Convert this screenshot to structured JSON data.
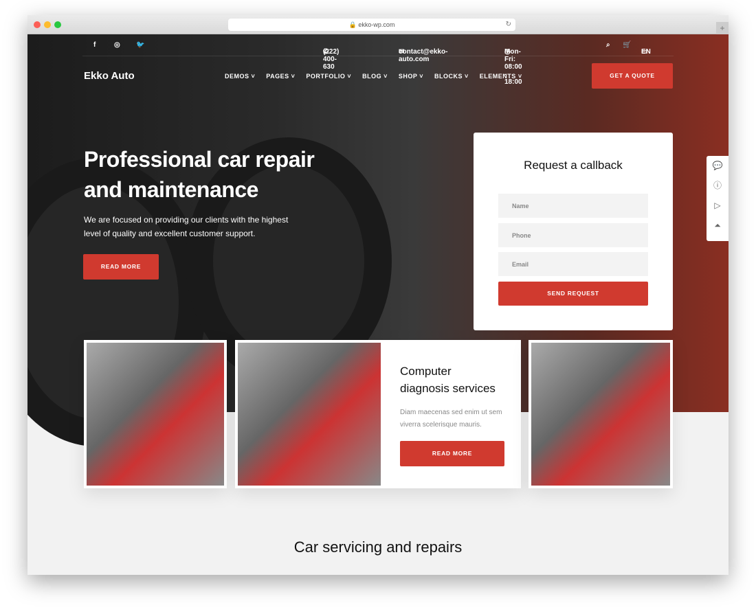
{
  "browser": {
    "url": "ekko-wp.com"
  },
  "topbar": {
    "social": [
      "f",
      "◎",
      "🐦"
    ],
    "phone": "(222) 400-630",
    "email": "contact@ekko-auto.com",
    "hours": "Mon-Fri: 08:00 - 18:00",
    "language": "EN"
  },
  "header": {
    "logo": "Ekko Auto",
    "nav": [
      "DEMOS",
      "PAGES",
      "PORTFOLIO",
      "BLOG",
      "SHOP",
      "BLOCKS",
      "ELEMENTS"
    ],
    "cta": "GET A QUOTE"
  },
  "hero": {
    "title_line1": "Professional car repair",
    "title_line2": "and maintenance",
    "subtitle": "We are focused on providing our clients with the highest level of quality and excellent customer support.",
    "button": "READ MORE"
  },
  "form": {
    "title": "Request a callback",
    "name_placeholder": "Name",
    "phone_placeholder": "Phone",
    "email_placeholder": "Email",
    "submit": "SEND REQUEST"
  },
  "feature": {
    "title_line1": "Computer",
    "title_line2": "diagnosis services",
    "description": "Diam maecenas sed enim ut sem viverra scelerisque mauris.",
    "button": "READ MORE"
  },
  "section": {
    "title": "Car servicing and repairs"
  },
  "colors": {
    "accent": "#d03a2f"
  }
}
